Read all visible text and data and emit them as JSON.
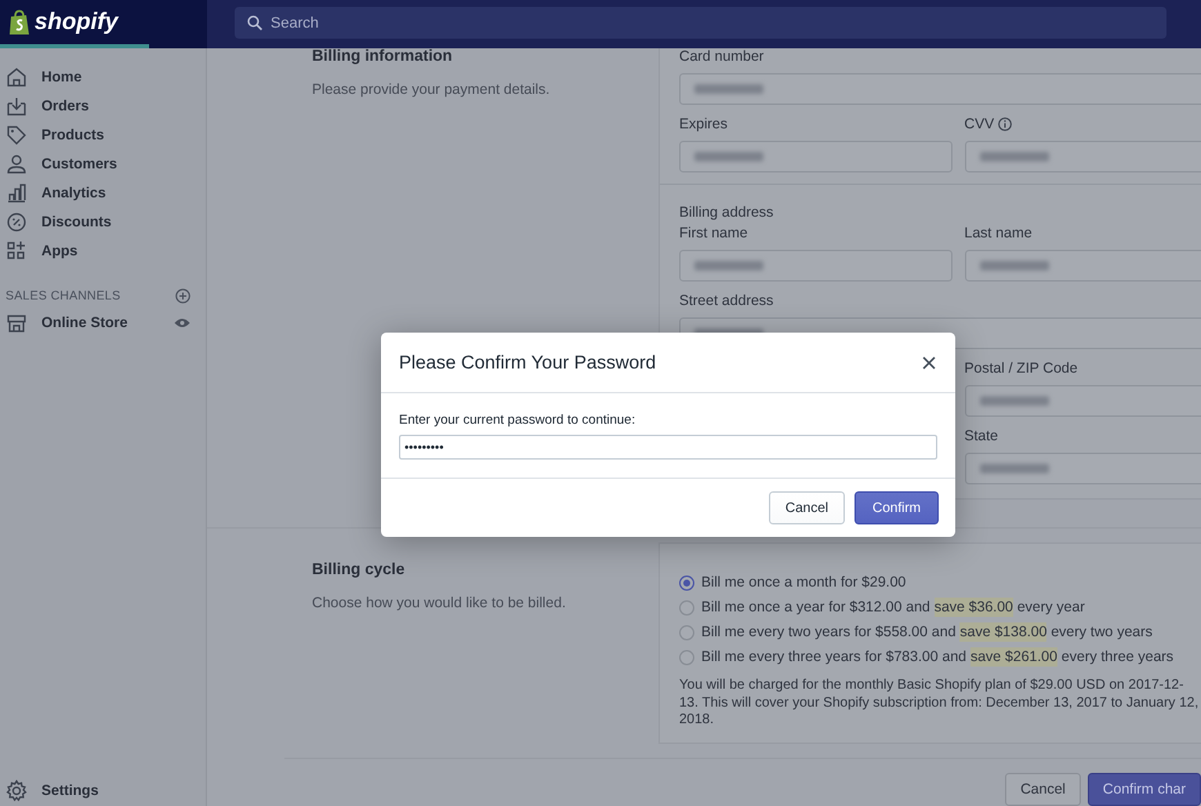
{
  "topbar": {
    "logo": "shopify",
    "search": {
      "placeholder": "Search"
    }
  },
  "sidebar": {
    "items": [
      {
        "label": "Home"
      },
      {
        "label": "Orders"
      },
      {
        "label": "Products"
      },
      {
        "label": "Customers"
      },
      {
        "label": "Analytics"
      },
      {
        "label": "Discounts"
      },
      {
        "label": "Apps"
      }
    ],
    "section": {
      "title": "SALES CHANNELS",
      "items": [
        {
          "label": "Online Store"
        }
      ]
    },
    "footer": {
      "label": "Settings"
    }
  },
  "billing_information": {
    "title": "Billing information",
    "description": "Please provide your payment details.",
    "payment_rows": [
      [
        {
          "label": "Card number",
          "info": false
        }
      ],
      [
        {
          "label": "Expires",
          "info": false
        },
        {
          "label": "CVV",
          "info": true
        }
      ]
    ],
    "address": {
      "heading": "Billing address",
      "rows": [
        [
          {
            "label": "First name",
            "info": false
          },
          {
            "label": "Last name",
            "info": false
          }
        ],
        [
          {
            "label": "Street address",
            "info": false
          }
        ]
      ],
      "right_column_rows": [
        [
          {
            "label": "Postal / ZIP Code",
            "info": false
          }
        ],
        [
          {
            "label": "State",
            "info": false
          }
        ]
      ]
    }
  },
  "billing_cycle": {
    "title": "Billing cycle",
    "description": "Choose how you would like to be billed.",
    "options": [
      {
        "label": "Bill me once a month for $29.00",
        "selected": true
      },
      {
        "label": "Bill me once a year for $312.00 and ",
        "highlight": "save $36.00",
        "after": " every year",
        "selected": false
      },
      {
        "label": "Bill me every two years for $558.00 and ",
        "highlight": "save $138.00",
        "after": " every two years",
        "selected": false
      },
      {
        "label": "Bill me every three years for $783.00 and ",
        "highlight": "save $261.00",
        "after": " every three years",
        "selected": false
      }
    ],
    "note": "You will be charged for the monthly Basic Shopify plan of $29.00 USD on 2017-12-13. This will cover your Shopify subscription from: December 13, 2017 to January 12, 2018."
  },
  "page_actions": [
    {
      "label": "Cancel",
      "kind": "secondary"
    },
    {
      "label": "Confirm char",
      "kind": "primary"
    }
  ],
  "modal": {
    "title": "Please Confirm Your Password",
    "label": "Enter your current password to continue:",
    "value": "•••••••••",
    "buttons": [
      {
        "label": "Cancel",
        "kind": "secondary"
      },
      {
        "label": "Confirm",
        "kind": "primary"
      }
    ]
  }
}
